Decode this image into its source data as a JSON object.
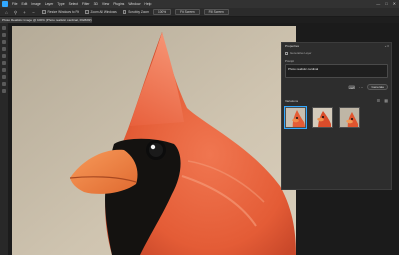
{
  "menubar": {
    "items": [
      "File",
      "Edit",
      "Image",
      "Layer",
      "Type",
      "Select",
      "Filter",
      "3D",
      "View",
      "Plugins",
      "Window",
      "Help"
    ],
    "minimize": "—",
    "maximize": "□",
    "close": "✕"
  },
  "options": {
    "resize_windows": "Resize Windows to Fit",
    "zoom_all_windows": "Zoom All Windows",
    "scrubby_zoom": "Scrubby Zoom",
    "zoom_100": "100%",
    "fit_screen": "Fit Screen",
    "fill_screen": "Fill Screen"
  },
  "document": {
    "tab_title": "Photo Realistic Image @ 100% (Photo realistic cardinal, RGB/8#) *"
  },
  "properties": {
    "title": "Properties",
    "subtitle": "Generative Layer",
    "prompt_label": "Prompt",
    "prompt_value": "Photo realistic cardinal",
    "generate_label": "Generate",
    "variations_label": "Variations"
  },
  "colors": {
    "accent": "#31a8ff",
    "app_bg": "#1e1e1e",
    "panel_bg": "#2d2d2d",
    "cardinal_red": "#e8603c"
  }
}
